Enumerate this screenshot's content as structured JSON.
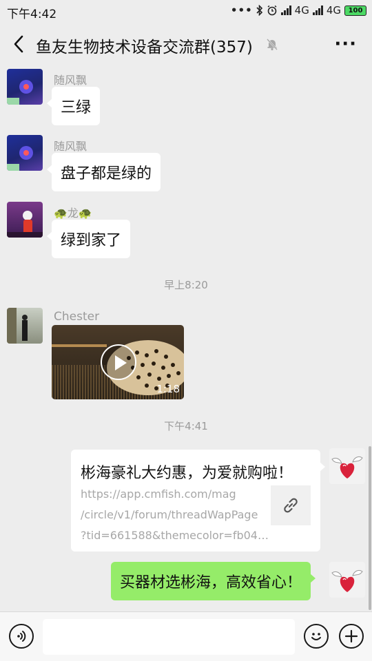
{
  "status_bar": {
    "time": "下午4:42",
    "network_1": "4G",
    "network_2": "4G",
    "battery": "100",
    "icons": [
      "more-dots-icon",
      "bluetooth-icon",
      "alarm-icon",
      "signal-icon",
      "battery-icon"
    ]
  },
  "header": {
    "title": "鱼友生物技术设备交流群(357)",
    "muted": true,
    "more_label": "···"
  },
  "messages": [
    {
      "type": "text",
      "sender": "随风飘",
      "text": "三绿"
    },
    {
      "type": "text",
      "sender": "随风飘",
      "text": "盘子都是绿的"
    },
    {
      "type": "text",
      "sender": "🐢龙🐢",
      "text": "绿到家了"
    },
    {
      "type": "time",
      "text": "早上8:20"
    },
    {
      "type": "video",
      "sender": "Chester",
      "duration": "1:18"
    },
    {
      "type": "time",
      "text": "下午4:41"
    },
    {
      "type": "link",
      "self": true,
      "title": "彬海豪礼大约惠，为爱就购啦！",
      "url_lines": [
        "https://app.cmfish.com/mag",
        "/circle/v1/forum/threadWapPage",
        "?tid=661588&themecolor=fb04…"
      ]
    },
    {
      "type": "text",
      "self": true,
      "text": "买器材选彬海，高效省心！"
    }
  ],
  "input_bar": {
    "value": "",
    "placeholder": ""
  },
  "colors": {
    "background": "#ededed",
    "self_bubble": "#95ec69",
    "other_bubble": "#ffffff",
    "battery": "#4cd964"
  }
}
